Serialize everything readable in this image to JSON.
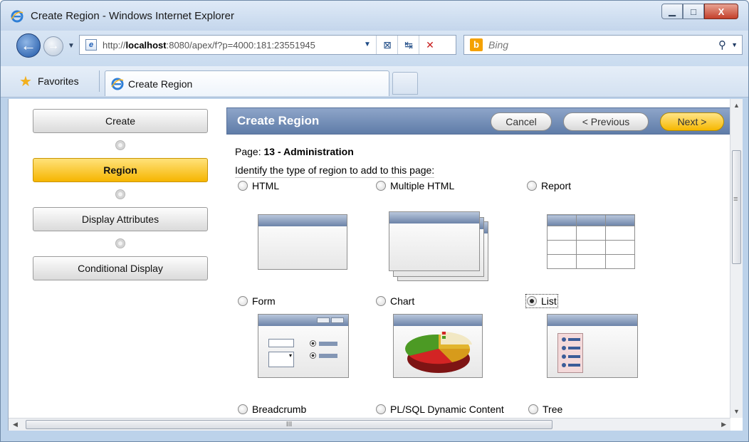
{
  "window": {
    "title": "Create Region - Windows Internet Explorer",
    "controls": {
      "minimize": "▁",
      "maximize": "□",
      "close": "X"
    }
  },
  "navbar": {
    "url_prefix": "http://",
    "url_host": "localhost",
    "url_rest": ":8080/apex/f?p=4000:181:23551945",
    "search_placeholder": "Bing",
    "search_brand_glyph": "b"
  },
  "favorites": {
    "label": "Favorites",
    "tab_label": "Create Region"
  },
  "wizard": {
    "steps": [
      {
        "label": "Create",
        "active": false
      },
      {
        "label": "Region",
        "active": true
      },
      {
        "label": "Display Attributes",
        "active": false
      },
      {
        "label": "Conditional Display",
        "active": false
      }
    ]
  },
  "region": {
    "title": "Create Region",
    "buttons": {
      "cancel": "Cancel",
      "previous": "< Previous",
      "next": "Next >"
    },
    "page_prefix": "Page: ",
    "page_value": "13 - Administration",
    "instruction": "Identify the type of region to add to this page:",
    "options": [
      {
        "label": "HTML",
        "checked": false,
        "icon": "html-region-icon"
      },
      {
        "label": "Multiple HTML",
        "checked": false,
        "icon": "multiple-html-region-icon"
      },
      {
        "label": "Report",
        "checked": false,
        "icon": "report-region-icon"
      },
      {
        "label": "Form",
        "checked": false,
        "icon": "form-region-icon"
      },
      {
        "label": "Chart",
        "checked": false,
        "icon": "chart-region-icon"
      },
      {
        "label": "List",
        "checked": true,
        "icon": "list-region-icon"
      },
      {
        "label": "Breadcrumb",
        "checked": false
      },
      {
        "label": "PL/SQL Dynamic Content",
        "checked": false
      },
      {
        "label": "Tree",
        "checked": false
      }
    ]
  },
  "scrollbar": {
    "hgrip": "III"
  },
  "colors": {
    "accent_yellow": "#f6b500",
    "region_header_blue": "#5f7ca8",
    "frame_blue": "#bcd2ea"
  }
}
